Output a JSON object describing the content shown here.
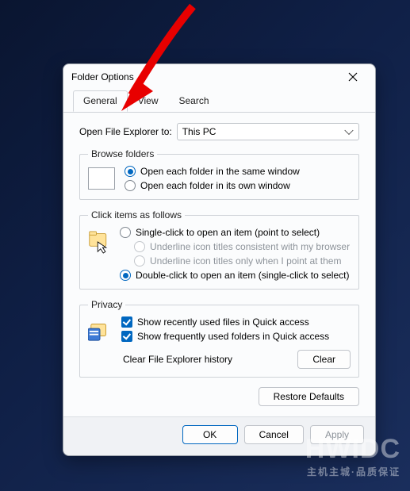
{
  "dialog": {
    "title": "Folder Options",
    "tabs": [
      "General",
      "View",
      "Search"
    ],
    "active_tab": 0,
    "open_label": "Open File Explorer to:",
    "open_value": "This PC",
    "browse": {
      "legend": "Browse folders",
      "opts": [
        "Open each folder in the same window",
        "Open each folder in its own window"
      ]
    },
    "click": {
      "legend": "Click items as follows",
      "opts": [
        "Single-click to open an item (point to select)",
        "Underline icon titles consistent with my browser",
        "Underline icon titles only when I point at them",
        "Double-click to open an item (single-click to select)"
      ]
    },
    "privacy": {
      "legend": "Privacy",
      "opts": [
        "Show recently used files in Quick access",
        "Show frequently used folders in Quick access"
      ],
      "clear_label": "Clear File Explorer history",
      "clear_btn": "Clear"
    },
    "restore": "Restore Defaults",
    "buttons": {
      "ok": "OK",
      "cancel": "Cancel",
      "apply": "Apply"
    }
  },
  "watermark": {
    "big": "HWIDC",
    "small": "主机主城·品质保证"
  }
}
